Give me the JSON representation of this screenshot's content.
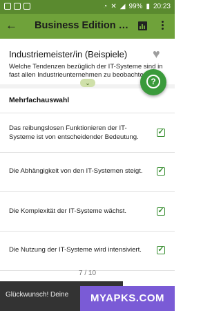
{
  "status_bar": {
    "battery": "99%",
    "time": "20:23",
    "color": "#5a8a2f"
  },
  "app_bar": {
    "title": "Business Edition Be...",
    "color": "#6fa23a"
  },
  "question": {
    "title": "Industriemeister/in (Beispiele)",
    "text": "Welche Tendenzen bezüglich der IT-Systeme sind in fast allen Industrieunternehmen zu beobachten?"
  },
  "section_label": "Mehrfachauswahl",
  "answers": [
    {
      "label": "Das reibungslosen Funktionieren der IT-Systeme ist von entscheidender Bedeutung.",
      "checked": true
    },
    {
      "label": "Die Abhängigkeit von den IT-Systemen steigt.",
      "checked": true
    },
    {
      "label": "Die Komplexität der IT-Systeme wächst.",
      "checked": true
    },
    {
      "label": "Die Nutzung der IT-Systeme wird intensiviert.",
      "checked": true
    }
  ],
  "pager": "7 / 10",
  "toast": "Glückwunsch! Deine",
  "watermark": "MYAPKS.COM"
}
